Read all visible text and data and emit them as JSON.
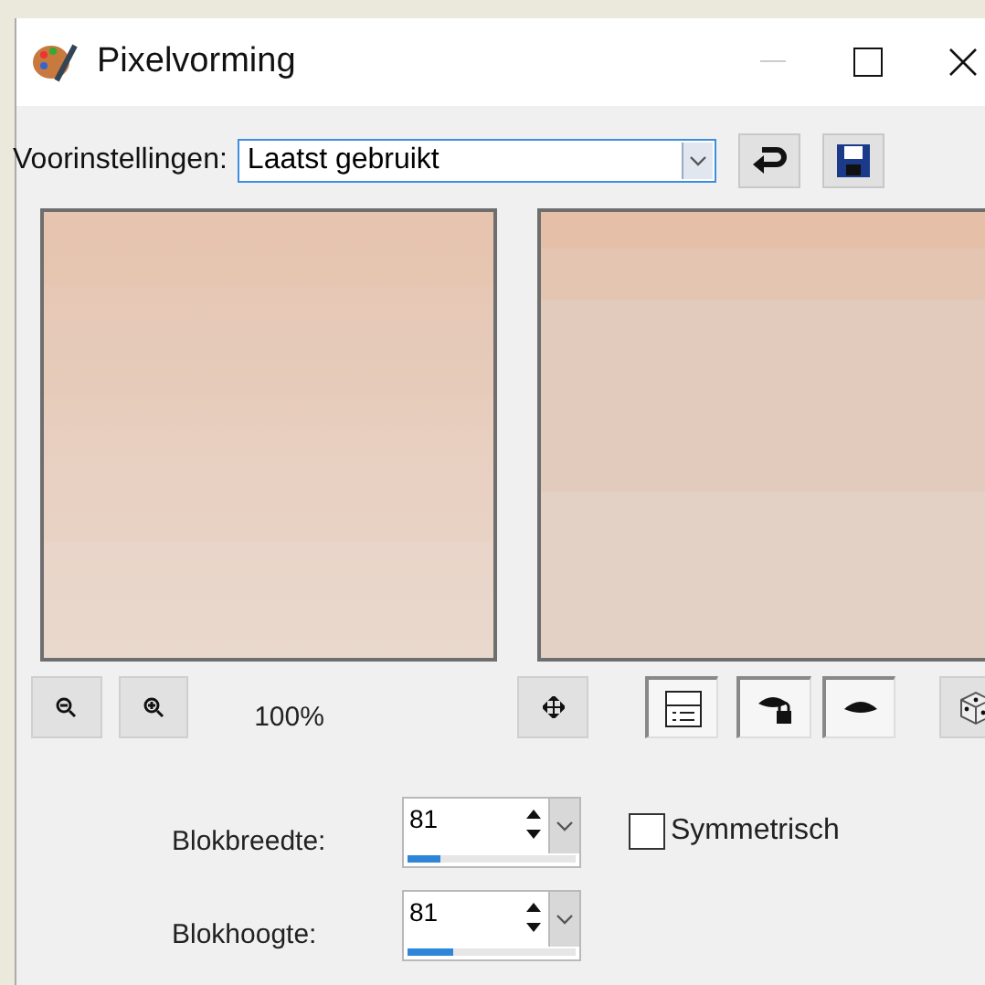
{
  "window": {
    "title": "Pixelvorming"
  },
  "presets": {
    "label": "Voorinstellingen:",
    "value": "Laatst gebruikt"
  },
  "zoom": {
    "reading": "100%"
  },
  "fields": [
    {
      "label": "Blokbreedte:",
      "value": "81",
      "level": 0.2
    },
    {
      "label": "Blokhoogte:",
      "value": "81",
      "level": 0.27
    }
  ],
  "checkbox": {
    "label": "Symmetrisch",
    "checked": false
  }
}
